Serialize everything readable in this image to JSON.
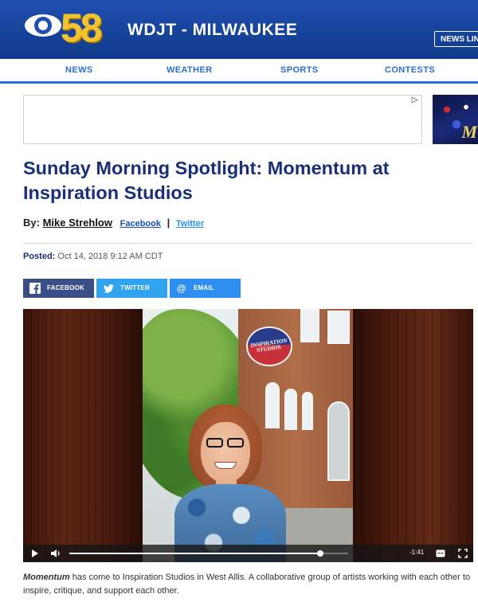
{
  "header": {
    "logo_number": "58",
    "station_name": "WDJT - MILWAUKEE",
    "newsline_label": "NEWS LINE",
    "brand_color": "#1a4aa8",
    "logo_color": "#f2c230"
  },
  "nav": {
    "items": [
      {
        "label": "NEWS"
      },
      {
        "label": "WEATHER"
      },
      {
        "label": "SPORTS"
      },
      {
        "label": "CONTESTS"
      }
    ]
  },
  "ad": {
    "choice_icon": "ad-choices-icon",
    "side_letter": "M"
  },
  "article": {
    "headline": "Sunday Morning Spotlight: Momentum at Inspiration Studios",
    "by_label": "By:",
    "author": "Mike Strehlow",
    "facebook_link": "Facebook",
    "separator": "|",
    "twitter_link": "Twitter",
    "posted_label": "Posted:",
    "posted_date": "Oct 14, 2018 9:12 AM CDT",
    "caption_title": "Momentum",
    "caption_rest": " has come to Inspiration Studios in West Allis. A collaborative group of artists working with each other to inspire, critique, and support each other."
  },
  "share": {
    "facebook": "FACEBOOK",
    "twitter": "TWITTER",
    "email": "EMAIL",
    "facebook_color": "#3a4f88",
    "twitter_color": "#2fa3ee",
    "email_color": "#2f8ff0"
  },
  "video": {
    "sign_text": "INSPIRATION STUDIOS",
    "time_remaining": "-1:41",
    "progress": 0.9
  }
}
